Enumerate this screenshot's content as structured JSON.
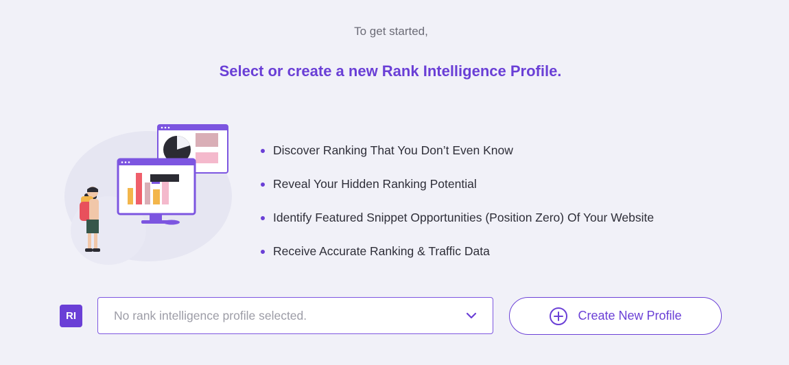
{
  "intro": {
    "text": "To get started,",
    "headline": "Select or create a new Rank Intelligence Profile."
  },
  "benefits": [
    "Discover Ranking That You Don’t Even Know",
    "Reveal Your Hidden Ranking Potential",
    "Identify Featured Snippet Opportunities (Position Zero) Of Your Website",
    "Receive Accurate Ranking & Traffic Data"
  ],
  "profile_selector": {
    "badge": "RI",
    "placeholder": "No rank intelligence profile selected.",
    "icon": "chevron-down-icon"
  },
  "create_button": {
    "label": "Create New Profile",
    "icon": "plus-circle-icon"
  },
  "colors": {
    "accent": "#6a3fd6",
    "background": "#f1f1f8",
    "text": "#2e2e38",
    "muted": "#9c9ca6"
  }
}
